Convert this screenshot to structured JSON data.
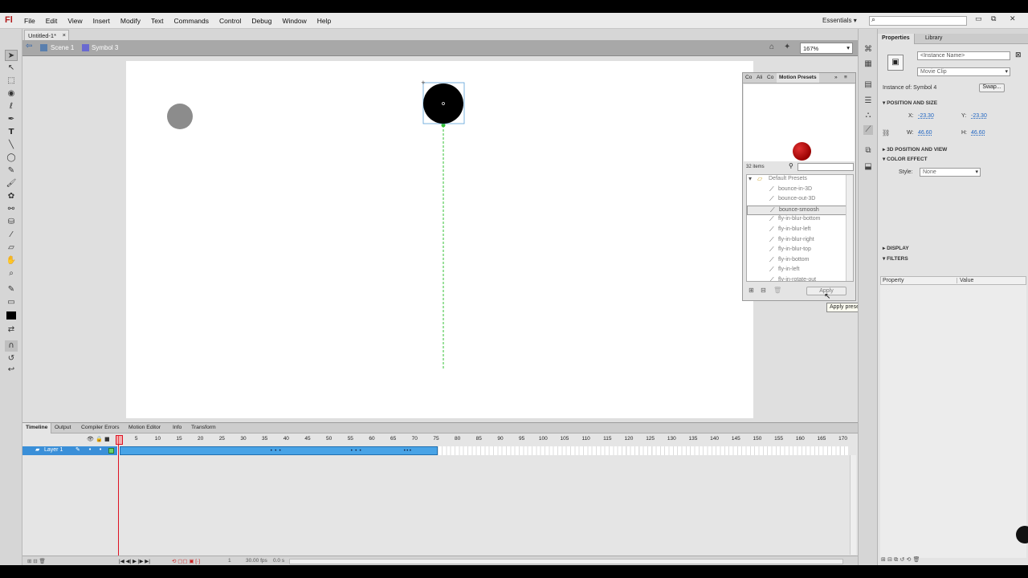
{
  "app": {
    "logo": "Fl"
  },
  "menu": [
    "File",
    "Edit",
    "View",
    "Insert",
    "Modify",
    "Text",
    "Commands",
    "Control",
    "Debug",
    "Window",
    "Help"
  ],
  "workspace": "Essentials",
  "window_buttons": [
    "▭",
    "⧉",
    "✕"
  ],
  "document": {
    "tab": "Untitled-1*",
    "tab_close": "×"
  },
  "breadcrumb": {
    "scene": "Scene 1",
    "symbol": "Symbol 3"
  },
  "zoom": "167%",
  "motion_presets": {
    "tabs": [
      "Co",
      "Ali",
      "Co",
      "Motion Presets"
    ],
    "count": "32 items",
    "folder": "Default Presets",
    "items": [
      "bounce-in-3D",
      "bounce-out-3D",
      "bounce-smoosh",
      "fly-in-blur-bottom",
      "fly-in-blur-left",
      "fly-in-blur-right",
      "fly-in-blur-top",
      "fly-in-bottom",
      "fly-in-left",
      "fly-in-rotate-out"
    ],
    "selected_index": 2,
    "apply": "Apply",
    "tooltip": "Apply preset to selection"
  },
  "properties": {
    "tabs": [
      "Properties",
      "Library"
    ],
    "instance_placeholder": "<Instance Name>",
    "type": "Movie Clip",
    "instance_of": "Instance of:  Symbol 4",
    "swap": "Swap...",
    "sections": {
      "pos": "POSITION AND SIZE",
      "pos3d": "3D POSITION AND VIEW",
      "color": "COLOR EFFECT",
      "display": "DISPLAY",
      "filters": "FILTERS"
    },
    "x_label": "X:",
    "x": "-23.30",
    "y_label": "Y:",
    "y": "-23.30",
    "w_label": "W:",
    "w": "46.60",
    "h_label": "H:",
    "h": "46.60",
    "style_label": "Style:",
    "style": "None",
    "filter_cols": [
      "Property",
      "Value"
    ]
  },
  "timeline": {
    "tabs": [
      "Timeline",
      "Output",
      "Compiler Errors",
      "Motion Editor",
      "Info",
      "Transform"
    ],
    "layer": "Layer 1",
    "ruler": [
      "5",
      "10",
      "15",
      "20",
      "25",
      "30",
      "35",
      "40",
      "45",
      "50",
      "55",
      "60",
      "65",
      "70",
      "75",
      "80",
      "85",
      "90",
      "95",
      "100",
      "105",
      "110",
      "115",
      "120",
      "125",
      "130",
      "135",
      "140",
      "145",
      "150",
      "155",
      "160",
      "165",
      "170"
    ],
    "frame": "1",
    "fps": "30.00 fps",
    "time": "0.0 s"
  },
  "colors": {
    "accent": "#3a8fd8",
    "frames": "#48a3e6",
    "ball_red": "#b01010",
    "ball_gray": "#8c8c8c",
    "ball_black": "#000000",
    "guide": "#35c035"
  }
}
